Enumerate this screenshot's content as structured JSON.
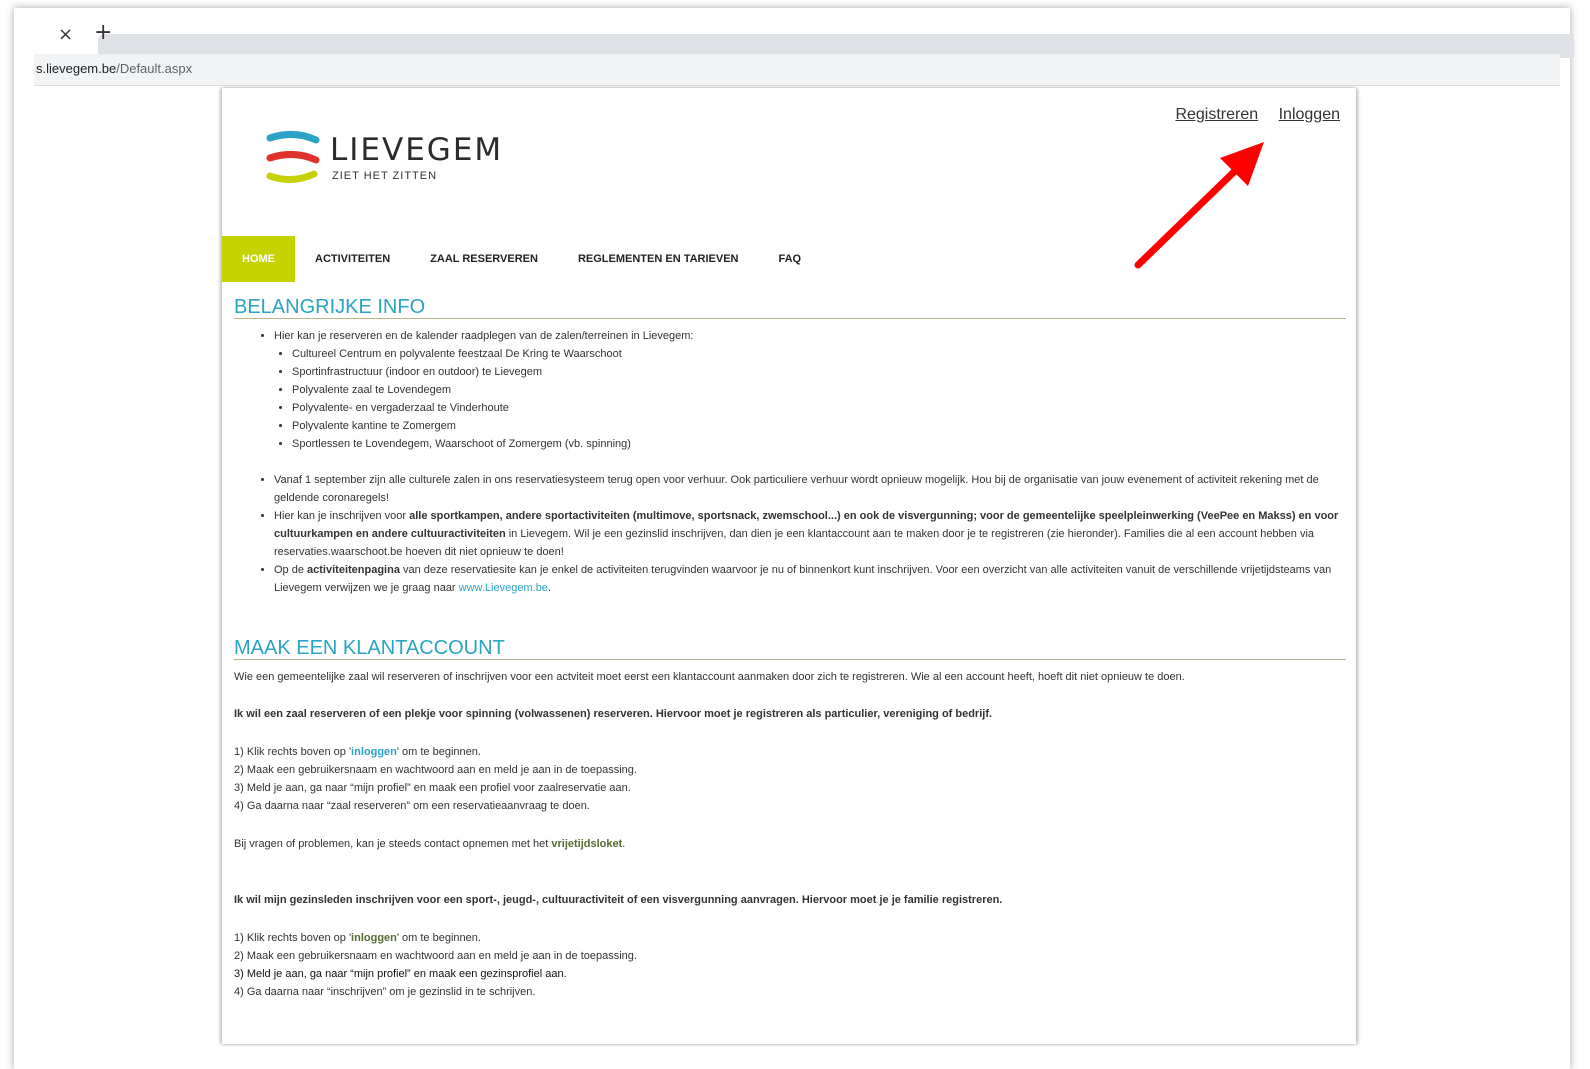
{
  "browser": {
    "tab_close": "×",
    "tab_new": "+",
    "url_host": "s.lievegem.be",
    "url_path": "/Default.aspx"
  },
  "header": {
    "register_label": "Registreren",
    "login_label": "Inloggen",
    "logo_text": "LIEVEGEM",
    "logo_tagline": "ZIET HET ZITTEN"
  },
  "nav": {
    "items": [
      {
        "label": "HOME"
      },
      {
        "label": "ACTIVITEITEN"
      },
      {
        "label": "ZAAL RESERVEREN"
      },
      {
        "label": "REGLEMENTEN EN TARIEVEN"
      },
      {
        "label": "FAQ"
      }
    ]
  },
  "info": {
    "title": "BELANGRIJKE INFO",
    "intro": "Hier kan je reserveren en de kalender raadplegen van de zalen/terreinen in Lievegem:",
    "venues": [
      "Cultureel Centrum en polyvalente feestzaal De Kring te Waarschoot",
      "Sportinfrastructuur (indoor en outdoor) te Lievegem",
      "Polyvalente zaal te Lovendegem",
      "Polyvalente- en vergaderzaal te Vinderhoute",
      "Polyvalente kantine te Zomergem",
      "Sportlessen te Lovendegem, Waarschoot of Zomergem (vb. spinning)"
    ],
    "bullet2": "Vanaf 1 september zijn alle culturele zalen in ons reservatiesysteem terug open voor verhuur. Ook particuliere verhuur wordt opnieuw mogelijk. Hou bij de organisatie van jouw evenement of activiteit rekening met de geldende coronaregels!",
    "bullet3_a": "Hier kan je inschrijven voor ",
    "bullet3_b": "alle sportkampen, andere sportactiviteiten (multimove, sportsnack, zwemschool...) en ook de visvergunning; voor de gemeentelijke speelpleinwerking (VeePee en Makss) en voor cultuurkampen en andere cultuuractiviteiten",
    "bullet3_c": " in Lievegem. Wil je een gezinslid inschrijven, dan dien je een klantaccount aan te maken door je te registreren (zie hieronder). Families die al een account hebben via reservaties.waarschoot.be hoeven dit niet opnieuw te doen!",
    "bullet4_a": "Op de ",
    "bullet4_b": "activiteitenpagina",
    "bullet4_c": " van deze reservatiesite kan je enkel de activiteiten terugvinden waarvoor je nu of binnenkort kunt inschrijven. Voor een overzicht van alle activiteiten vanuit de verschillende vrijetijdsteams van Lievegem verwijzen we je graag naar ",
    "bullet4_link": "www.Lievegem.be",
    "bullet4_end": "."
  },
  "account": {
    "title": "MAAK EEN KLANTACCOUNT",
    "intro": "Wie een gemeentelijke zaal wil reserveren of inschrijven voor een actviteit moet eerst een klantaccount aanmaken door zich te registreren. Wie al een account heeft, hoeft dit niet opnieuw te doen.",
    "section1_title": "Ik wil een zaal reserveren of een plekje voor spinning (volwassenen) reserveren. Hiervoor moet je registreren als particulier, vereniging of bedrijf.",
    "s1_step1_a": "1)  Klik rechts boven op '",
    "s1_step1_link": "inloggen",
    "s1_step1_b": "' om te beginnen.",
    "s1_step2": "2)  Maak een gebruikersnaam en wachtwoord aan en meld je aan in de toepassing.",
    "s1_step3": "3)  Meld je aan, ga naar “mijn profiel” en maak een profiel voor zaalreservatie aan.",
    "s1_step4": "4)  Ga daarna naar “zaal reserveren” om een reservatieaanvraag te doen.",
    "contact_a": "Bij vragen of problemen, kan je steeds contact opnemen met het ",
    "contact_link": "vrijetijdsloket",
    "contact_b": ".",
    "section2_title": "Ik wil mijn gezinsleden inschrijven voor een sport-, jeugd-, cultuuractiviteit of een visvergunning aanvragen. Hiervoor moet je je familie registreren.",
    "s2_step1_a": "1)  Klik rechts boven op '",
    "s2_step1_link": "inloggen",
    "s2_step1_b": "' om te beginnen.",
    "s2_step2": "2)  Maak een gebruikersnaam en wachtwoord aan en meld je aan in de toepassing.",
    "s2_step3": "3)  Meld je aan, ga naar “mijn profiel” en maak een gezinsprofiel aan.",
    "s2_step4": "4)  Ga daarna naar “inschrijven” om je gezinslid in te schrijven."
  },
  "colors": {
    "accent_blue": "#2aa3c4",
    "nav_active": "#c6d100",
    "arrow_red": "#ff0000"
  }
}
